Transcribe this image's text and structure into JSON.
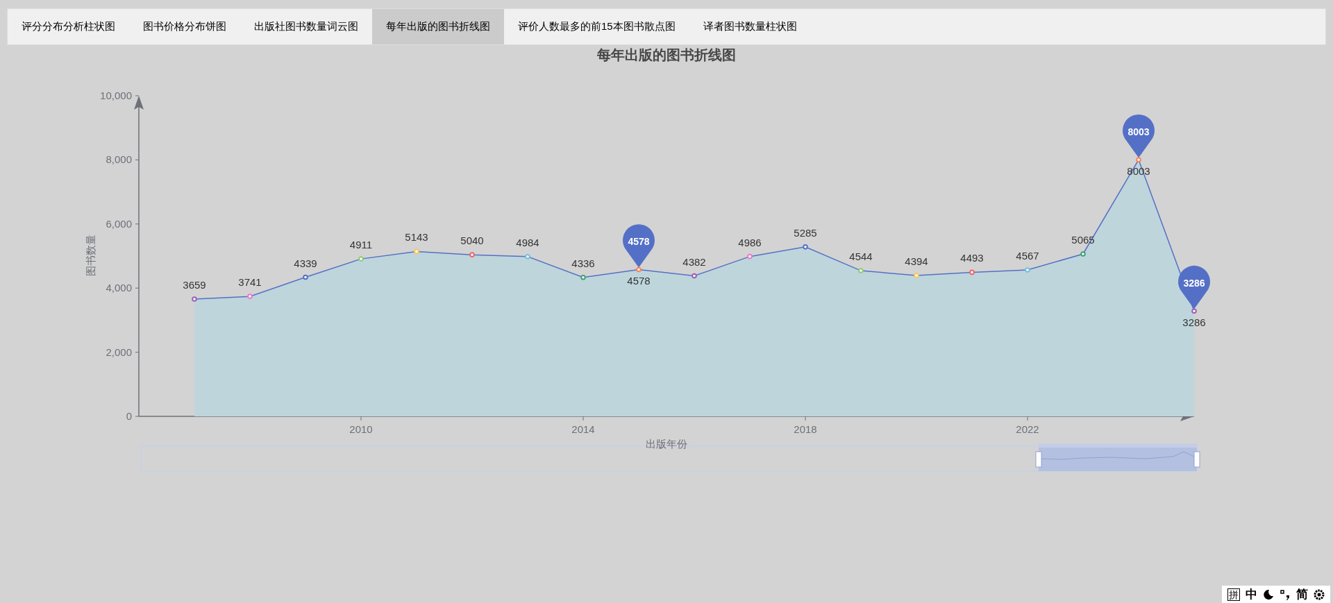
{
  "tabs": [
    {
      "label": "评分分布分析柱状图",
      "selected": false
    },
    {
      "label": "图书价格分布饼图",
      "selected": false
    },
    {
      "label": "出版社图书数量词云图",
      "selected": false
    },
    {
      "label": "每年出版的图书折线图",
      "selected": true
    },
    {
      "label": "评价人数最多的前15本图书散点图",
      "selected": false
    },
    {
      "label": "译者图书数量柱状图",
      "selected": false
    }
  ],
  "chart": {
    "title": "每年出版的图书折线图",
    "chart_data": {
      "type": "area",
      "xlabel": "出版年份",
      "ylabel": "图书数量",
      "x": [
        2007,
        2008,
        2009,
        2010,
        2011,
        2012,
        2013,
        2014,
        2015,
        2016,
        2017,
        2018,
        2019,
        2020,
        2021,
        2022,
        2023,
        2024,
        2025
      ],
      "series": [
        {
          "color": "#5470c6",
          "values": [
            3659,
            3741,
            4339,
            4911,
            5143,
            5040,
            4984,
            4336,
            4578,
            4382,
            4986,
            5285,
            4544,
            4394,
            4493,
            4567,
            5065,
            8003,
            3286
          ]
        }
      ],
      "xlim": [
        2006,
        2025
      ],
      "ylim": [
        0,
        10000
      ],
      "xticks": [
        2010,
        2014,
        2018,
        2022
      ],
      "yticks": [
        {
          "value": 0,
          "label": "0"
        },
        {
          "value": 2000,
          "label": "2,000"
        },
        {
          "value": 4000,
          "label": "4,000"
        },
        {
          "value": 6000,
          "label": "6,000"
        },
        {
          "value": 8000,
          "label": "8,000"
        },
        {
          "value": 10000,
          "label": "10,000"
        }
      ],
      "data_labels": true,
      "annotations": [
        {
          "x": 2015,
          "y": 4578,
          "text": "4578"
        },
        {
          "x": 2024,
          "y": 8003,
          "text": "8003"
        },
        {
          "x": 2025,
          "y": 3286,
          "text": "3286"
        }
      ]
    },
    "point_markers": [
      {
        "color": "#9a60b4"
      },
      {
        "color": "#ea7ccc"
      },
      {
        "color": "#5470c6"
      },
      {
        "color": "#91cc75"
      },
      {
        "color": "#fac858"
      },
      {
        "color": "#ee6666"
      },
      {
        "color": "#73c0de"
      },
      {
        "color": "#3ba272"
      },
      {
        "color": "#fc8452"
      },
      {
        "color": "#9a60b4"
      },
      {
        "color": "#ea7ccc"
      },
      {
        "color": "#5470c6"
      },
      {
        "color": "#91cc75"
      },
      {
        "color": "#fac858"
      },
      {
        "color": "#ee6666"
      },
      {
        "color": "#73c0de"
      },
      {
        "color": "#3ba272"
      },
      {
        "color": "#fc8452"
      },
      {
        "color": "#9a60b4"
      }
    ]
  },
  "ime_bar": {
    "items": [
      {
        "kind": "boxed",
        "text": "拼"
      },
      {
        "kind": "text",
        "text": "中"
      },
      {
        "kind": "moon"
      },
      {
        "kind": "punct"
      },
      {
        "kind": "text",
        "text": "简"
      },
      {
        "kind": "gear"
      }
    ]
  }
}
